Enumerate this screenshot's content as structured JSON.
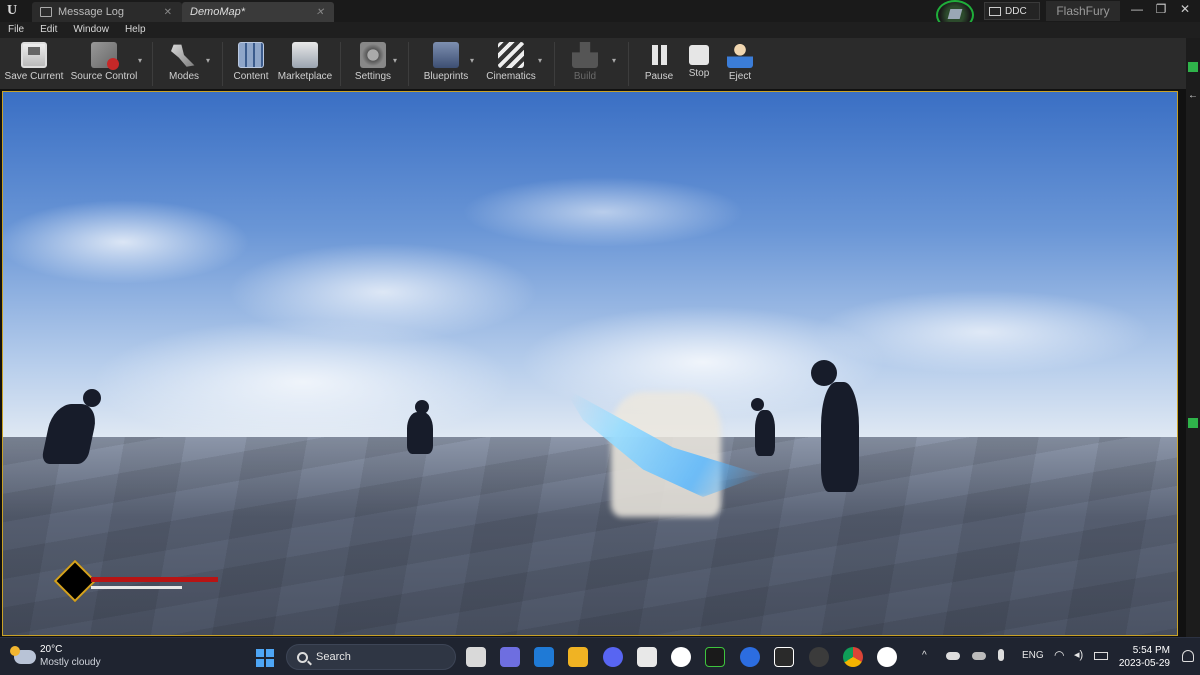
{
  "titlebar": {
    "logo": "U",
    "tabs": [
      {
        "label": "Message Log",
        "close": "✕"
      },
      {
        "label": "DemoMap*",
        "close": "✕"
      }
    ],
    "ddc_label": "DDC",
    "project_name": "FlashFury",
    "window_controls": [
      "—",
      "❐",
      "✕"
    ]
  },
  "menu": [
    "File",
    "Edit",
    "Window",
    "Help"
  ],
  "toolbar": {
    "save_current": "Save Current",
    "source_control": "Source Control",
    "modes": "Modes",
    "content": "Content",
    "marketplace": "Marketplace",
    "settings": "Settings",
    "blueprints": "Blueprints",
    "cinematics": "Cinematics",
    "build": "Build",
    "pause": "Pause",
    "stop": "Stop",
    "eject": "Eject",
    "dropdown_glyph": "▾"
  },
  "hud": {
    "health_fraction": 1.0,
    "stamina_fraction": 0.72,
    "health_color": "#b81414",
    "stamina_color": "#e8e8e8",
    "emblem_border_color": "#d5a21e"
  },
  "taskbar": {
    "weather": {
      "temp": "20°C",
      "condition": "Mostly cloudy",
      "icon": "partly-cloudy-icon"
    },
    "search_placeholder": "Search",
    "tray_language": "ENG",
    "tray_chevron": "^",
    "time": "5:54 PM",
    "date": "2023-05-29",
    "apps": [
      "file-explorer-icon",
      "teams-icon",
      "mail-icon",
      "folder-icon",
      "discord-icon",
      "store-icon",
      "slack-icon",
      "razer-icon",
      "media-player-icon",
      "epic-games-icon",
      "obs-icon",
      "chrome-icon",
      "unreal-engine-icon"
    ]
  },
  "colors": {
    "accent_green": "#1fae3a",
    "viewport_border": "#c9a227",
    "windows_blue": "#4ea6f5"
  }
}
